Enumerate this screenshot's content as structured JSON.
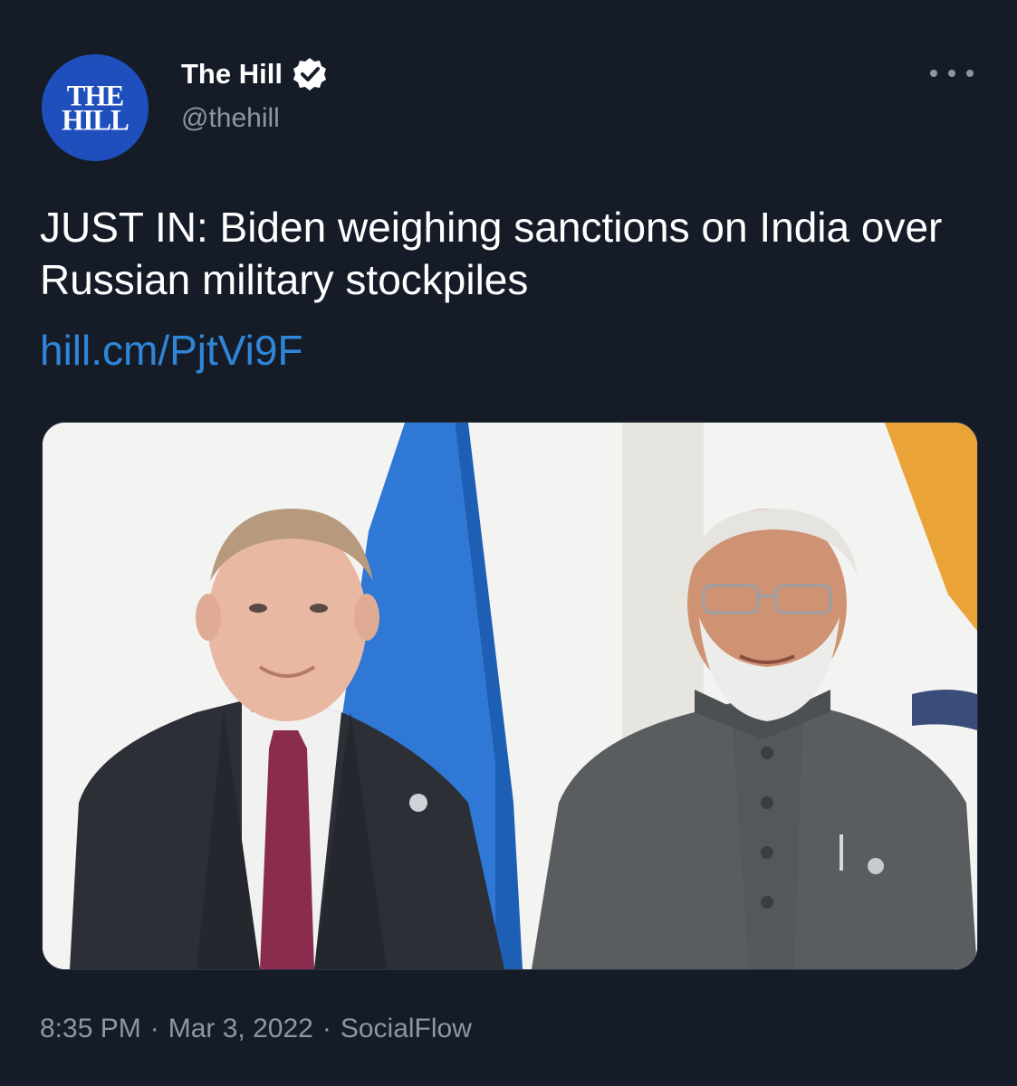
{
  "author": {
    "display_name": "The Hill",
    "handle": "@thehill",
    "avatar_logo_lines": [
      "THE",
      "HILL"
    ],
    "verified": true
  },
  "tweet": {
    "text": "JUST IN: Biden weighing sanctions on India over Russian military stockpiles",
    "link": "hill.cm/PjtVi9F",
    "media": {
      "type": "photo",
      "description_icon": "photo-icon"
    }
  },
  "meta": {
    "time": "8:35 PM",
    "separator": "·",
    "date": "Mar 3, 2022",
    "source": "SocialFlow"
  },
  "colors": {
    "background": "#151c28",
    "text": "#ffffff",
    "secondary": "#8c97a4",
    "link": "#2f86d8",
    "verified": "#ffffff",
    "avatar": "#1f4fbd"
  }
}
